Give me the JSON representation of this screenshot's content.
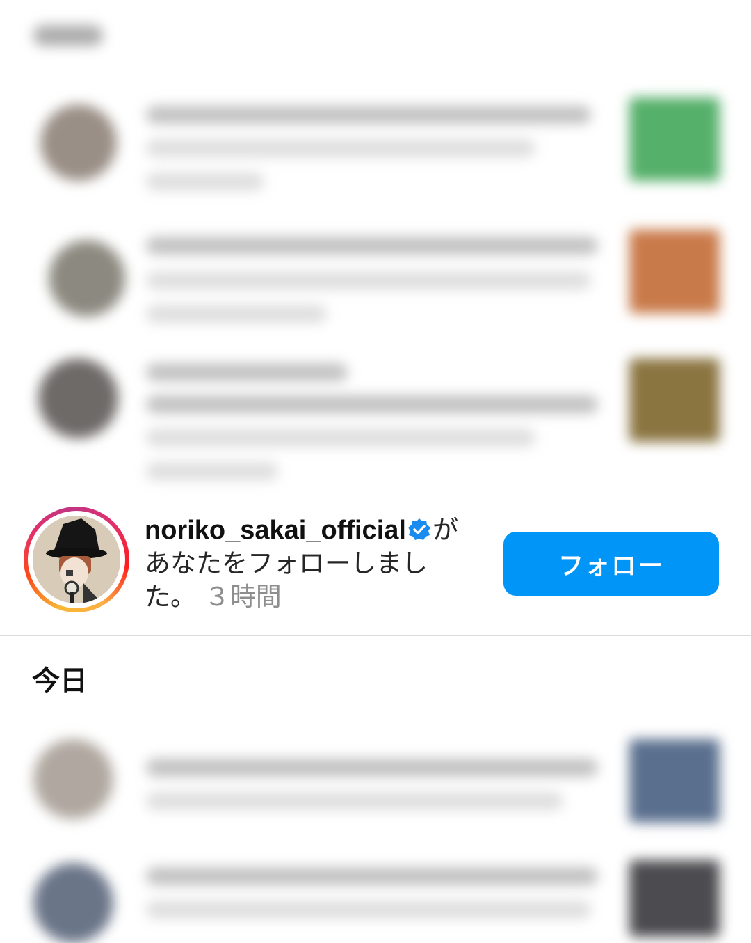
{
  "focused_notification": {
    "username": "noriko_sakai_official",
    "suffix": "が",
    "message": "あなたをフォローしまし",
    "message_end": "た。",
    "time": "３時間",
    "follow_button_label": "フォロー",
    "verified_icon": "verified-badge-icon",
    "colors": {
      "follow_button": "#0095f6",
      "verified": "#1a8cf0",
      "ring": "#e1306c"
    }
  },
  "sections": {
    "today_label": "今日"
  }
}
